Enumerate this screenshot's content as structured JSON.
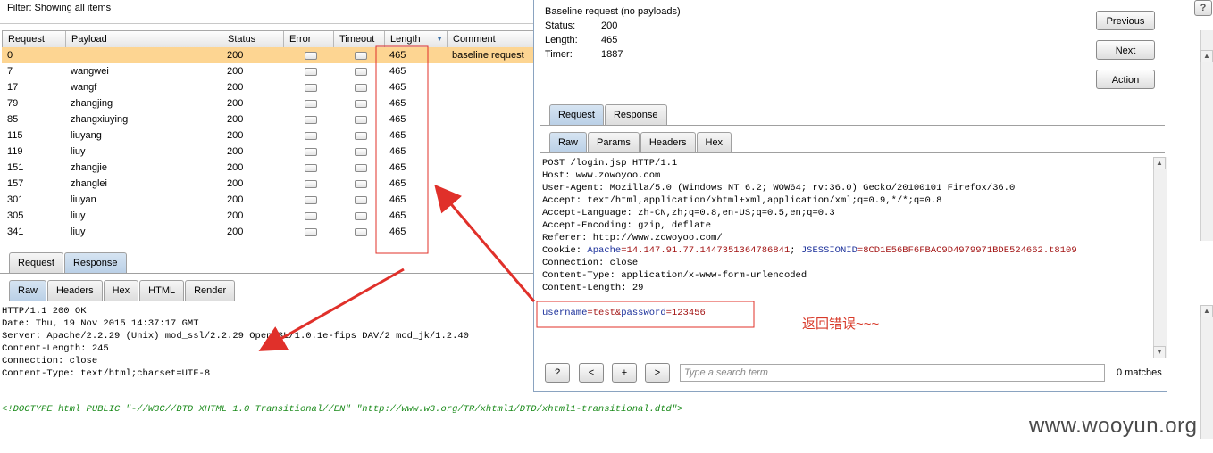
{
  "filter": {
    "text": "Filter:  Showing all items"
  },
  "table": {
    "columns": [
      "Request",
      "Payload",
      "Status",
      "Error",
      "Timeout",
      "Length",
      "Comment"
    ],
    "rows": [
      {
        "request": "0",
        "payload": "",
        "status": "200",
        "length": "465",
        "comment": "baseline request"
      },
      {
        "request": "7",
        "payload": "wangwei",
        "status": "200",
        "length": "465",
        "comment": ""
      },
      {
        "request": "17",
        "payload": "wangf",
        "status": "200",
        "length": "465",
        "comment": ""
      },
      {
        "request": "79",
        "payload": "zhangjing",
        "status": "200",
        "length": "465",
        "comment": ""
      },
      {
        "request": "85",
        "payload": "zhangxiuying",
        "status": "200",
        "length": "465",
        "comment": ""
      },
      {
        "request": "115",
        "payload": "liuyang",
        "status": "200",
        "length": "465",
        "comment": ""
      },
      {
        "request": "119",
        "payload": "liuy",
        "status": "200",
        "length": "465",
        "comment": ""
      },
      {
        "request": "151",
        "payload": "zhangjie",
        "status": "200",
        "length": "465",
        "comment": ""
      },
      {
        "request": "157",
        "payload": "zhanglei",
        "status": "200",
        "length": "465",
        "comment": ""
      },
      {
        "request": "301",
        "payload": "liuyan",
        "status": "200",
        "length": "465",
        "comment": ""
      },
      {
        "request": "305",
        "payload": "liuy",
        "status": "200",
        "length": "465",
        "comment": ""
      },
      {
        "request": "341",
        "payload": "liuy",
        "status": "200",
        "length": "465",
        "comment": ""
      }
    ]
  },
  "bottom_tabs": {
    "request": "Request",
    "response": "Response"
  },
  "bottom_subtabs": {
    "raw": "Raw",
    "headers": "Headers",
    "hex": "Hex",
    "html": "HTML",
    "render": "Render"
  },
  "response_lines": [
    "HTTP/1.1 200 OK",
    "Date: Thu, 19 Nov 2015 14:37:17 GMT",
    "Server: Apache/2.2.29 (Unix) mod_ssl/2.2.29 OpenSSL/1.0.1e-fips DAV/2 mod_jk/1.2.40",
    "Content-Length: 245",
    "Connection: close",
    "Content-Type: text/html;charset=UTF-8"
  ],
  "doctype": "<!DOCTYPE html PUBLIC \"-//W3C//DTD XHTML 1.0 Transitional//EN\" \"http://www.w3.org/TR/xhtml1/DTD/xhtml1-transitional.dtd\">",
  "panel": {
    "title": "Baseline request (no payloads)",
    "status_label": "Status:",
    "status_value": "200",
    "length_label": "Length:",
    "length_value": "465",
    "timer_label": "Timer:",
    "timer_value": "1887",
    "previous": "Previous",
    "next": "Next",
    "action": "Action",
    "tabs": {
      "request": "Request",
      "response": "Response"
    },
    "subtabs": {
      "raw": "Raw",
      "params": "Params",
      "headers": "Headers",
      "hex": "Hex"
    },
    "request_lines": [
      "POST /login.jsp HTTP/1.1",
      "Host: www.zowoyoo.com",
      "User-Agent: Mozilla/5.0 (Windows NT 6.2; WOW64; rv:36.0) Gecko/20100101 Firefox/36.0",
      "Accept: text/html,application/xhtml+xml,application/xml;q=0.9,*/*;q=0.8",
      "Accept-Language: zh-CN,zh;q=0.8,en-US;q=0.5,en;q=0.3",
      "Accept-Encoding: gzip, deflate",
      "Referer: http://www.zowoyoo.com/"
    ],
    "cookie_prefix": "Cookie: ",
    "cookie_apache_key": "Apache",
    "cookie_apache_val": "=14.147.91.77.1447351364786841",
    "cookie_sep": "; ",
    "cookie_jsession_key": "JSESSIONID",
    "cookie_jsession_val": "=8CD1E56BF6FBAC9D4979971BDE524662.t8109",
    "request_lines_after": [
      "Connection: close",
      "Content-Type: application/x-www-form-urlencoded",
      "Content-Length: 29"
    ],
    "body_user_key": "username",
    "body_user_val": "=test&",
    "body_pass_key": "password",
    "body_pass_val": "=123456",
    "search_help": "?",
    "search_prev": "<",
    "search_add": "+",
    "search_next": ">",
    "search_placeholder": "Type a search term",
    "matches": "0 matches"
  },
  "annotation_note": "返回错误~~~",
  "watermark": "www.wooyun.org",
  "help_corner": "?",
  "colors": {
    "selected_row": "#fdd592",
    "annotation_red": "#e0302a",
    "tab_active": "#c4d7ec"
  }
}
